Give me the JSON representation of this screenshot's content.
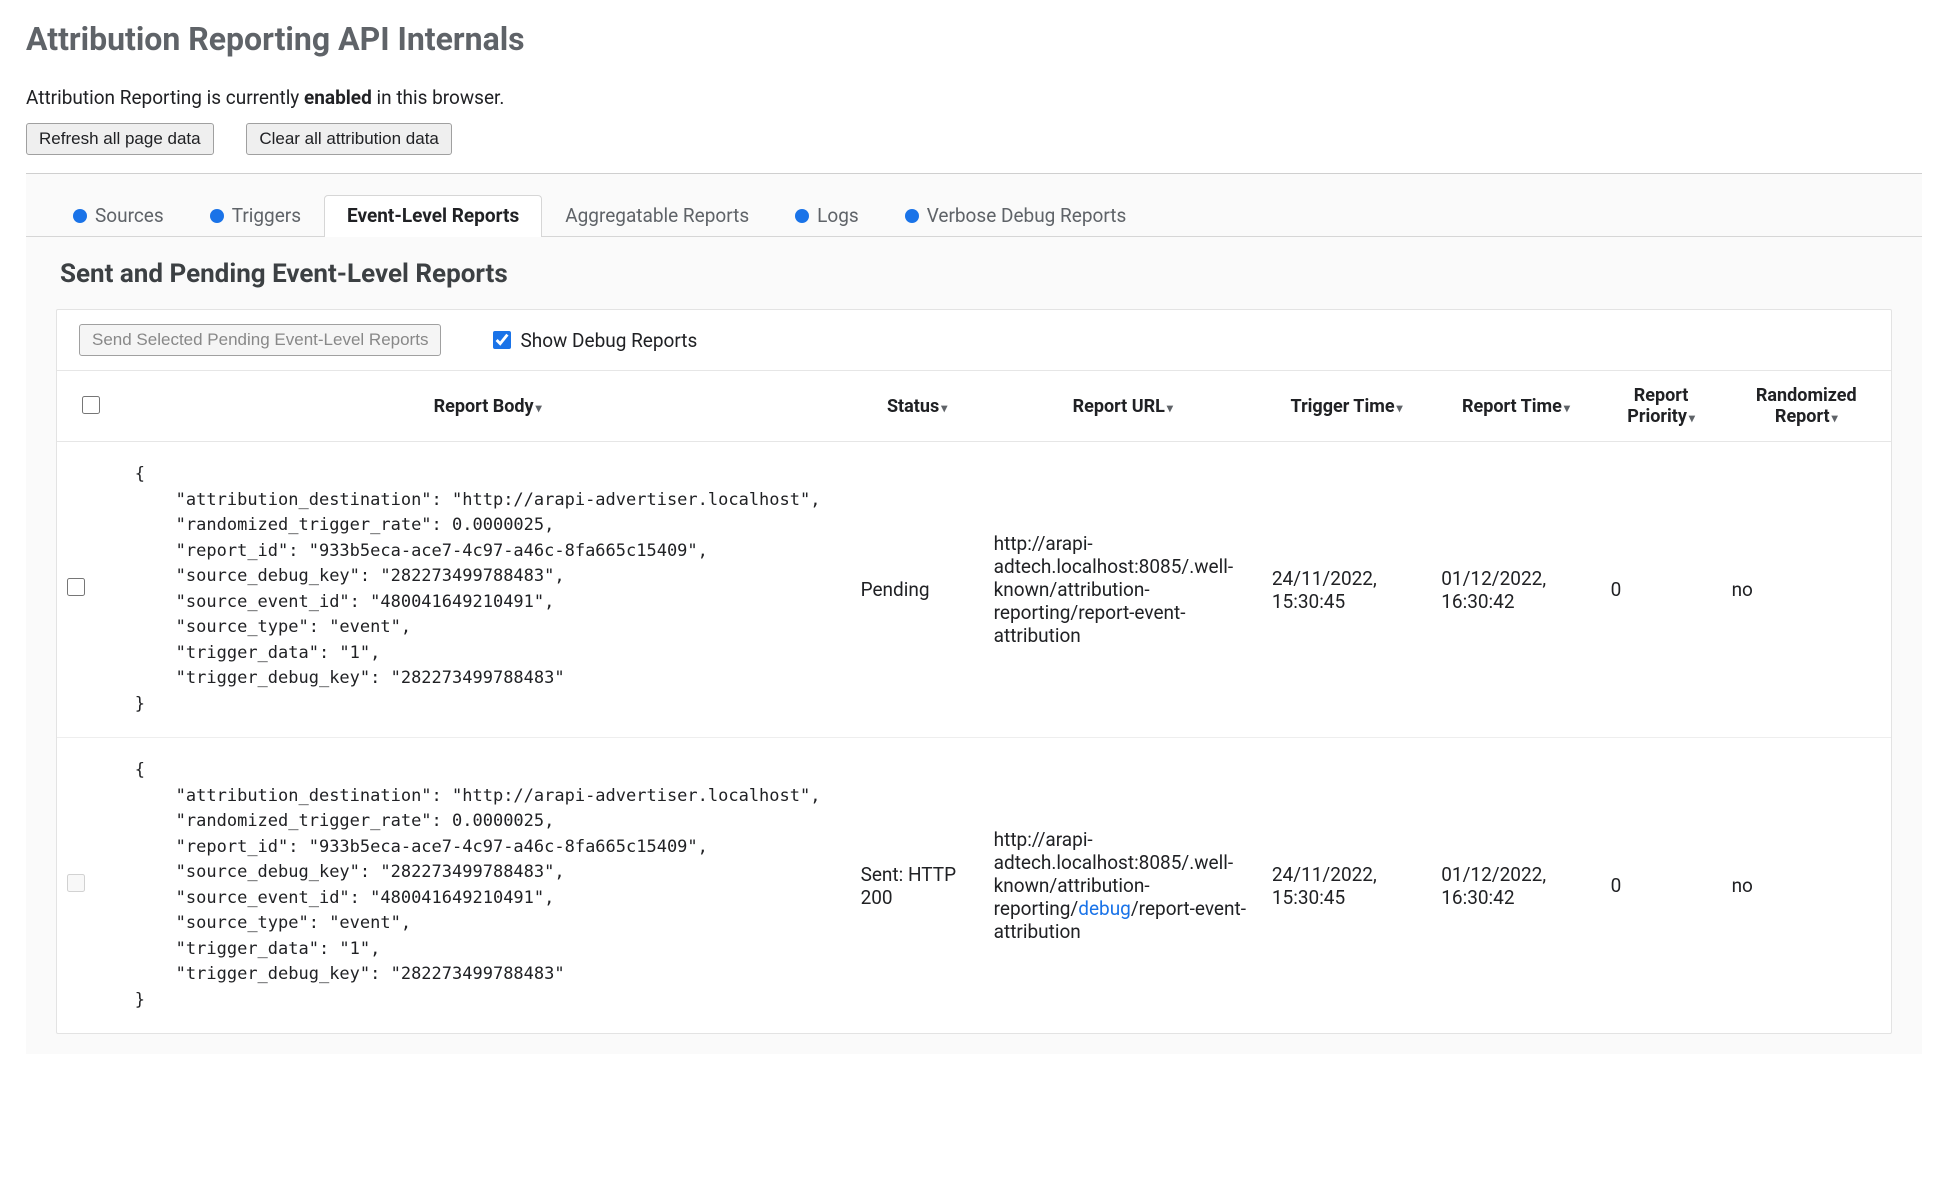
{
  "page": {
    "title": "Attribution Reporting API Internals",
    "status_prefix": "Attribution Reporting is currently ",
    "status_keyword": "enabled",
    "status_suffix": " in this browser."
  },
  "buttons": {
    "refresh": "Refresh all page data",
    "clear": "Clear all attribution data"
  },
  "tabs": [
    {
      "label": "Sources",
      "dot": true,
      "active": false
    },
    {
      "label": "Triggers",
      "dot": true,
      "active": false
    },
    {
      "label": "Event-Level Reports",
      "dot": false,
      "active": true
    },
    {
      "label": "Aggregatable Reports",
      "dot": false,
      "active": false
    },
    {
      "label": "Logs",
      "dot": true,
      "active": false
    },
    {
      "label": "Verbose Debug Reports",
      "dot": true,
      "active": false
    }
  ],
  "section": {
    "title": "Sent and Pending Event-Level Reports"
  },
  "toolbar": {
    "send_selected": "Send Selected Pending Event-Level Reports",
    "show_debug_label": "Show Debug Reports",
    "show_debug_checked": true
  },
  "columns": {
    "body": "Report Body",
    "status": "Status",
    "url": "Report URL",
    "trigger_time": "Trigger Time",
    "report_time": "Report Time",
    "priority": "Report Priority",
    "randomized": "Randomized Report"
  },
  "rows": [
    {
      "selectable": true,
      "body": "{\n    \"attribution_destination\": \"http://arapi-advertiser.localhost\",\n    \"randomized_trigger_rate\": 0.0000025,\n    \"report_id\": \"933b5eca-ace7-4c97-a46c-8fa665c15409\",\n    \"source_debug_key\": \"282273499788483\",\n    \"source_event_id\": \"480041649210491\",\n    \"source_type\": \"event\",\n    \"trigger_data\": \"1\",\n    \"trigger_debug_key\": \"282273499788483\"\n}",
      "status": "Pending",
      "url_pre": "http://arapi-adtech.localhost:8085/.well-known/attribution-reporting/report-event-attribution",
      "url_debug": "",
      "url_post": "",
      "trigger_time": "24/11/2022, 15:30:45",
      "report_time": "01/12/2022, 16:30:42",
      "priority": "0",
      "randomized": "no"
    },
    {
      "selectable": false,
      "body": "{\n    \"attribution_destination\": \"http://arapi-advertiser.localhost\",\n    \"randomized_trigger_rate\": 0.0000025,\n    \"report_id\": \"933b5eca-ace7-4c97-a46c-8fa665c15409\",\n    \"source_debug_key\": \"282273499788483\",\n    \"source_event_id\": \"480041649210491\",\n    \"source_type\": \"event\",\n    \"trigger_data\": \"1\",\n    \"trigger_debug_key\": \"282273499788483\"\n}",
      "status": "Sent: HTTP 200",
      "url_pre": "http://arapi-adtech.localhost:8085/.well-known/attribution-reporting/",
      "url_debug": "debug",
      "url_post": "/report-event-attribution",
      "trigger_time": "24/11/2022, 15:30:45",
      "report_time": "01/12/2022, 16:30:42",
      "priority": "0",
      "randomized": "no"
    }
  ]
}
